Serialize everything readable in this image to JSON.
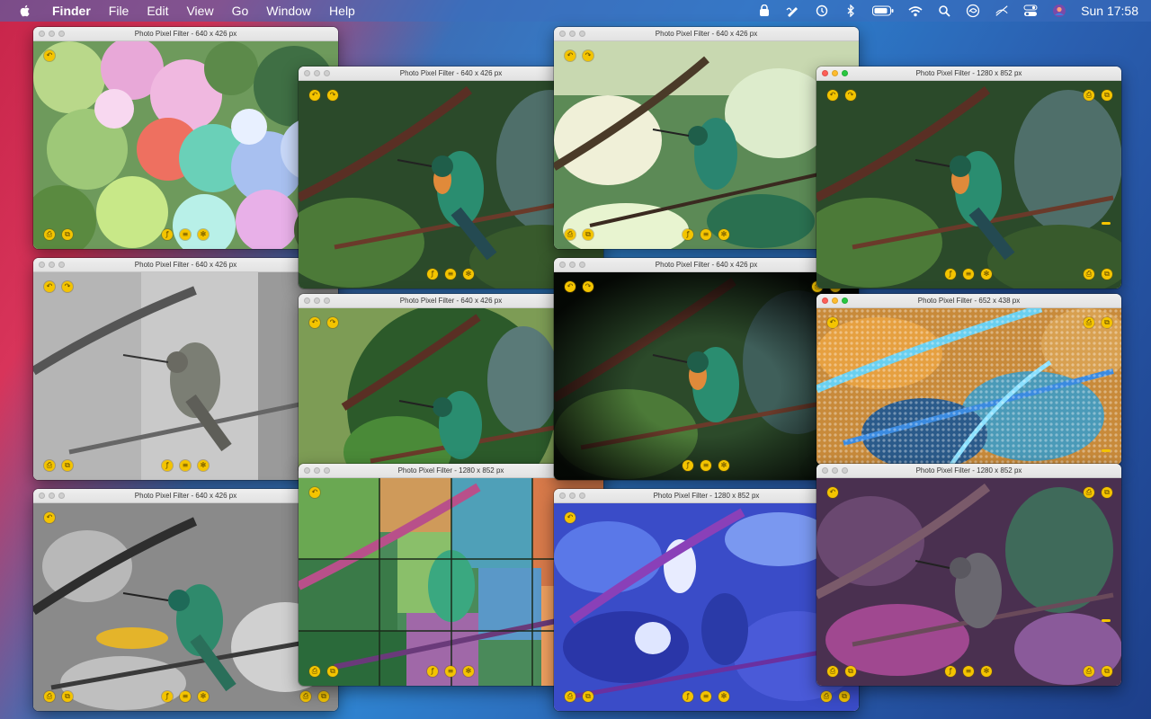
{
  "menubar": {
    "apple_icon": "apple-icon",
    "items": [
      "Finder",
      "File",
      "Edit",
      "View",
      "Go",
      "Window",
      "Help"
    ],
    "status_icons": [
      "vpn-icon",
      "pen-icon",
      "time-machine-icon",
      "bluetooth-icon",
      "battery-icon",
      "wifi-icon",
      "search-icon",
      "siri-like-icon",
      "mute-icon",
      "control-center-icon",
      "user-avatar-icon"
    ],
    "clock": "Sun 17:58"
  },
  "accent_color": "#f4c400",
  "windows": [
    {
      "title": "Photo Pixel Filter - 640 x 426 px",
      "filter": "watercolor-blotch"
    },
    {
      "title": "Photo Pixel Filter - 640 x 426 px",
      "filter": "original"
    },
    {
      "title": "Photo Pixel Filter - 640 x 426 px",
      "filter": "oil-paint"
    },
    {
      "title": "Photo Pixel Filter - 1280 x 852 px",
      "filter": "original"
    },
    {
      "title": "Photo Pixel Filter - 640 x 426 px",
      "filter": "pencil-sketch"
    },
    {
      "title": "Photo Pixel Filter - 640 x 426 px",
      "filter": "circle-vignette"
    },
    {
      "title": "Photo Pixel Filter - 640 x 426 px",
      "filter": "dark-vignette"
    },
    {
      "title": "Photo Pixel Filter - 652 x 438 px",
      "filter": "pointillism"
    },
    {
      "title": "Photo Pixel Filter - 640 x 426 px",
      "filter": "color-splash"
    },
    {
      "title": "Photo Pixel Filter - 1280 x 852 px",
      "filter": "stained-glass"
    },
    {
      "title": "Photo Pixel Filter - 1280 x 852 px",
      "filter": "blue-emboss"
    },
    {
      "title": "Photo Pixel Filter - 1280 x 852 px",
      "filter": "purple-tint"
    }
  ],
  "toolbar_icons": {
    "undo": "↶",
    "redo": "↷",
    "save": "⎙",
    "copy": "⧉",
    "filter": "ƒ",
    "adjust": "≡",
    "effects": "✻"
  }
}
